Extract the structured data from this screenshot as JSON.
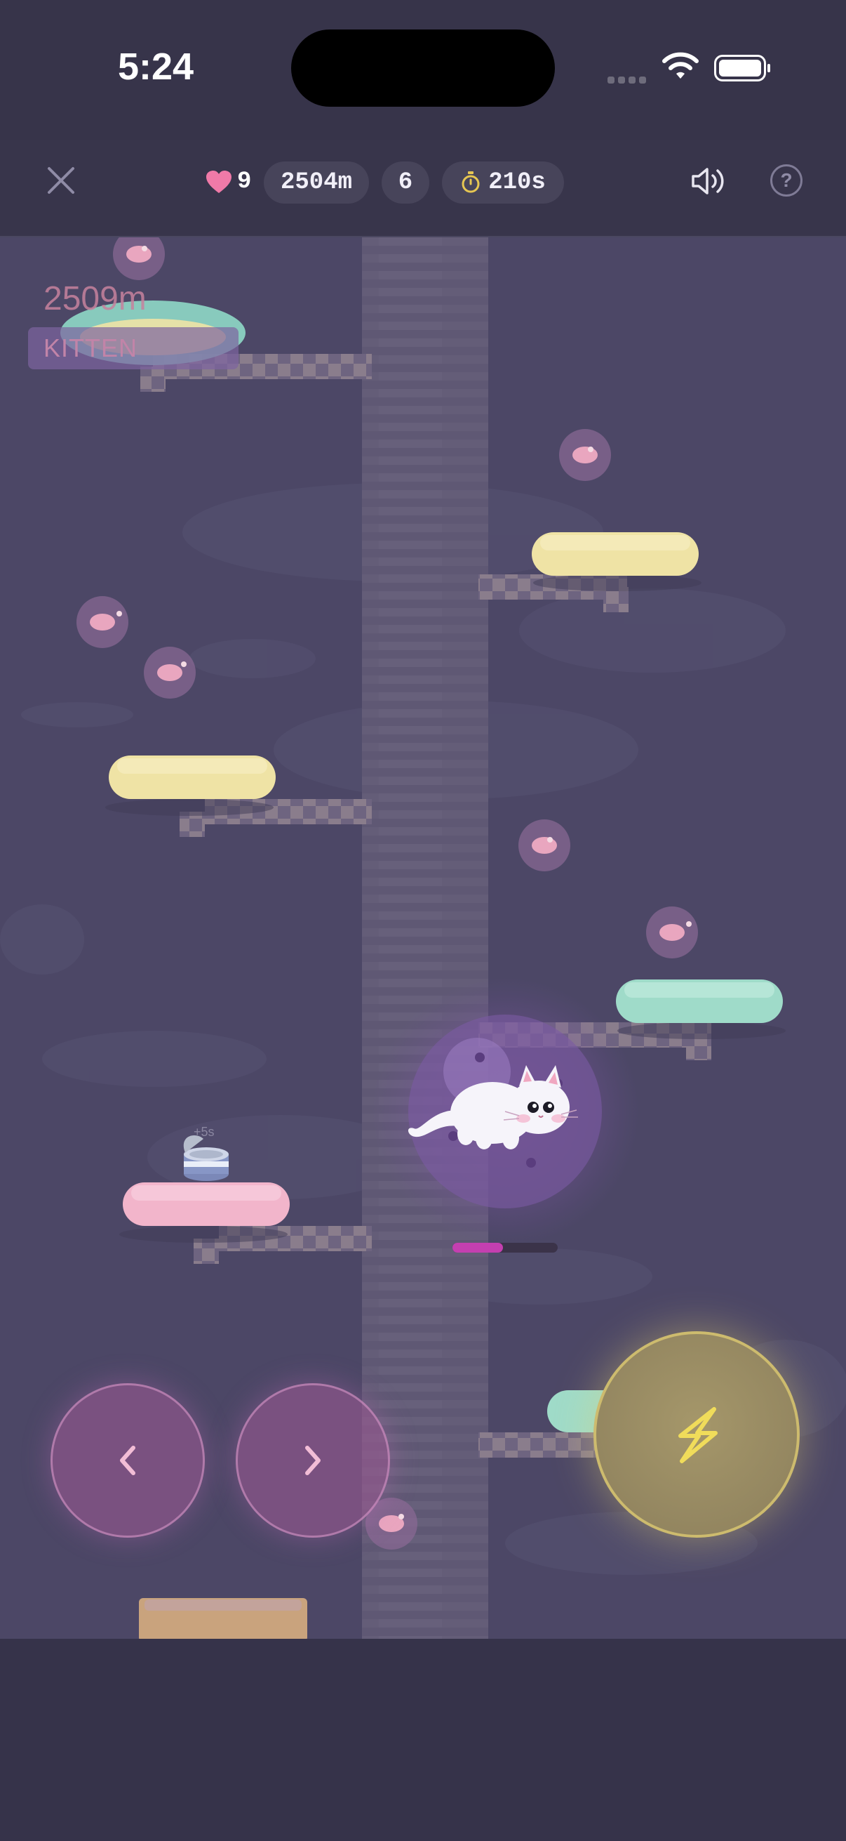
{
  "status_bar": {
    "time": "5:24"
  },
  "hud": {
    "lives": "9",
    "distance": "2504m",
    "level": "6",
    "timer": "210s"
  },
  "best": {
    "distance": "2509m",
    "label": "KITTEN"
  },
  "pickup": {
    "bonus_label": "+5s"
  },
  "boost": {
    "progress": 0.48
  },
  "colors": {
    "heart": "#f07aa8",
    "boost_bar": "#c43fb0",
    "platform_yellow": "#efe3a5",
    "platform_pink": "#f2b5cb",
    "platform_teal": "#9fdbc9",
    "platform_tan": "#c9a37d",
    "timer_icon": "#e6c652",
    "background": "#4c4766"
  },
  "icons": {
    "close": "close-icon",
    "heart": "heart-icon",
    "timer": "stopwatch-icon",
    "sound": "speaker-icon",
    "help": "help-icon",
    "left": "chevron-left-icon",
    "right": "chevron-right-icon",
    "boost": "lightning-icon"
  }
}
